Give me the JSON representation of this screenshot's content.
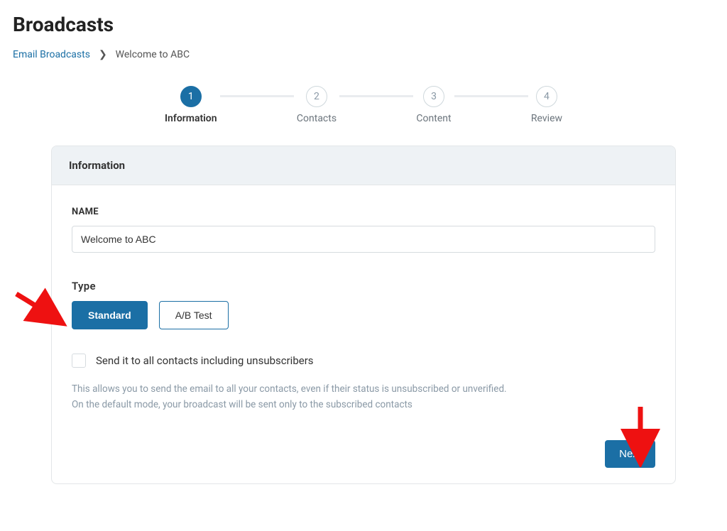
{
  "page_title": "Broadcasts",
  "breadcrumb": {
    "root": "Email Broadcasts",
    "current": "Welcome to ABC"
  },
  "stepper": {
    "steps": [
      {
        "num": "1",
        "label": "Information"
      },
      {
        "num": "2",
        "label": "Contacts"
      },
      {
        "num": "3",
        "label": "Content"
      },
      {
        "num": "4",
        "label": "Review"
      }
    ],
    "active_index": 0
  },
  "card": {
    "header": "Information",
    "name_label": "NAME",
    "name_value": "Welcome to ABC",
    "type_label": "Type",
    "type_options": {
      "standard": "Standard",
      "abtest": "A/B Test"
    },
    "checkbox_label": "Send it to all contacts including unsubscribers",
    "help_line1": "This allows you to send the email to all your contacts, even if their status is unsubscribed or unverified.",
    "help_line2": "On the default mode, your broadcast will be sent only to the subscribed contacts",
    "next_label": "Next"
  }
}
